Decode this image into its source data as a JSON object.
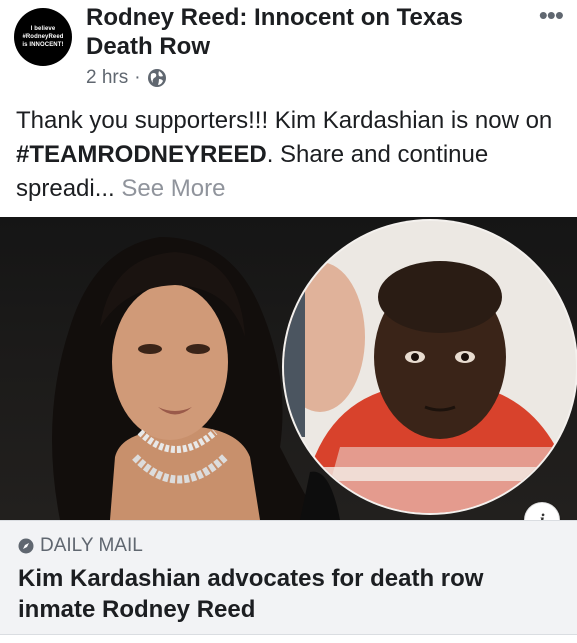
{
  "page": {
    "avatar_lines": [
      "I believe",
      "#RodneyReed",
      "is INNOCENT!"
    ],
    "name": "Rodney Reed: Innocent on Texas Death Row"
  },
  "post": {
    "time": "2 hrs",
    "separator": "·",
    "privacy_icon": "globe-icon",
    "text_before": "Thank you supporters!!!  Kim Kardashian is now on ",
    "hashtag": "#TEAMRODNEYREED",
    "text_after": ".   Share and continue spreadi... ",
    "see_more": "See More",
    "more_menu": "•••"
  },
  "link": {
    "source_icon": "compass-icon",
    "source": "DAILY MAIL",
    "headline": "Kim Kardashian advocates for death row inmate Rodney Reed",
    "info_icon": "i"
  },
  "colors": {
    "text": "#1c1e21",
    "secondary": "#606770",
    "link_card_bg": "#f2f3f5",
    "see_more": "#90949c"
  }
}
